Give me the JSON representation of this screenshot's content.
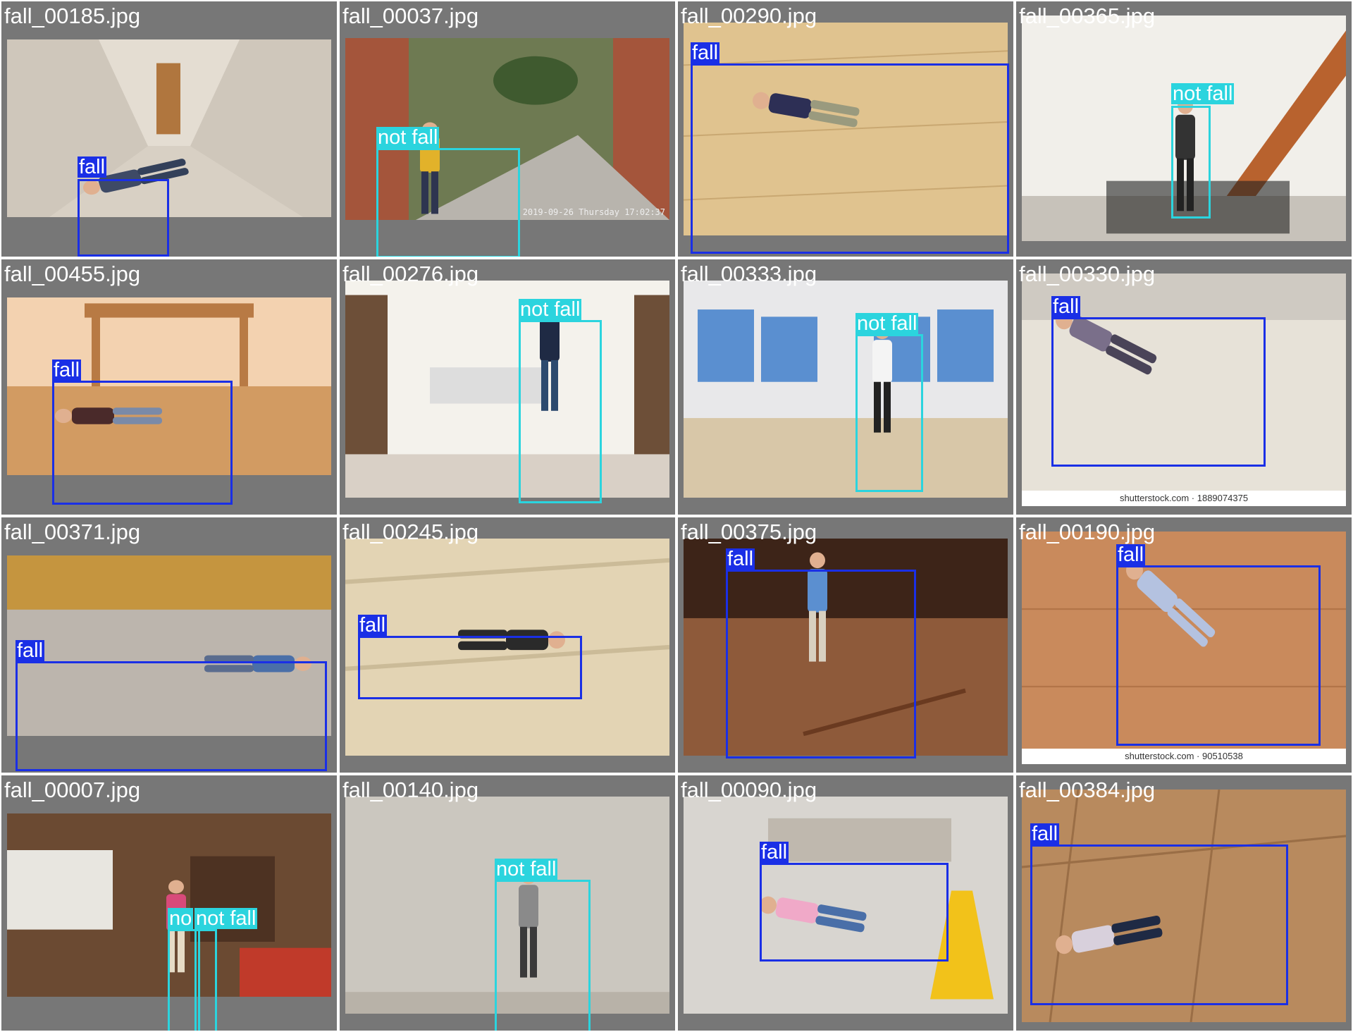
{
  "colors": {
    "fall": "#1a2fe6",
    "not_fall": "#2bd4de",
    "tile_bg": "#777777"
  },
  "tiles": [
    {
      "filename": "fall_00185.jpg",
      "labels": [
        "fall"
      ],
      "scene": "hallway"
    },
    {
      "filename": "fall_00037.jpg",
      "labels": [
        "not fall"
      ],
      "scene": "doorbell-camera",
      "stamp": "2019-09-26 Thursday 17:02:37"
    },
    {
      "filename": "fall_00290.jpg",
      "labels": [
        "fall"
      ],
      "scene": "wood-floor"
    },
    {
      "filename": "fall_00365.jpg",
      "labels": [
        "not fall"
      ],
      "scene": "living-room-stairs"
    },
    {
      "filename": "fall_00455.jpg",
      "labels": [
        "fall"
      ],
      "scene": "dining-floor"
    },
    {
      "filename": "fall_00276.jpg",
      "labels": [
        "not fall"
      ],
      "scene": "vacuuming-room"
    },
    {
      "filename": "fall_00333.jpg",
      "labels": [
        "not fall"
      ],
      "scene": "empty-room"
    },
    {
      "filename": "fall_00330.jpg",
      "labels": [
        "fall"
      ],
      "scene": "carpet-room",
      "watermark": "shutterstock.com · 1889074375"
    },
    {
      "filename": "fall_00371.jpg",
      "labels": [
        "fall"
      ],
      "scene": "carpet-floor"
    },
    {
      "filename": "fall_00245.jpg",
      "labels": [
        "fall"
      ],
      "scene": "stairs-outdoor"
    },
    {
      "filename": "fall_00375.jpg",
      "labels": [
        "fall"
      ],
      "scene": "sofa-floor"
    },
    {
      "filename": "fall_00190.jpg",
      "labels": [
        "fall"
      ],
      "scene": "parquet",
      "watermark": "shutterstock.com · 90510538"
    },
    {
      "filename": "fall_00007.jpg",
      "labels": [
        "no",
        "not fall"
      ],
      "scene": "kitchen"
    },
    {
      "filename": "fall_00140.jpg",
      "labels": [
        "not fall"
      ],
      "scene": "concrete-wall"
    },
    {
      "filename": "fall_00090.jpg",
      "labels": [
        "fall"
      ],
      "scene": "wet-floor"
    },
    {
      "filename": "fall_00384.jpg",
      "labels": [
        "fall"
      ],
      "scene": "tile-floor"
    }
  ]
}
